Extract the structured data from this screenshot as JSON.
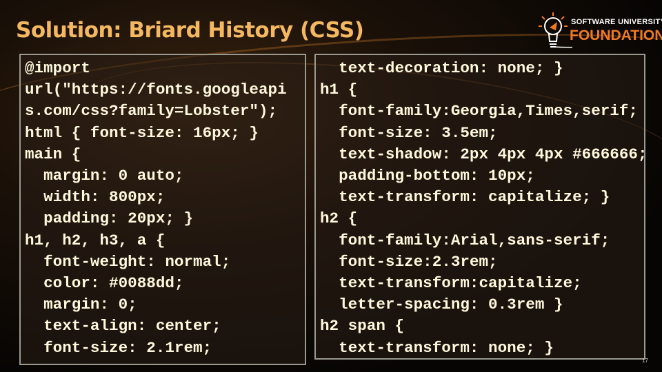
{
  "title": "Solution: Briard History (CSS)",
  "logo": {
    "line1": "SOFTWARE UNIVERSITY",
    "line2": "FOUNDATION"
  },
  "left_code": [
    "@import",
    "url(\"https://fonts.googleapi",
    "s.com/css?family=Lobster\");",
    "html { font-size: 16px; }",
    "main {",
    "  margin: 0 auto;",
    "  width: 800px;",
    "  padding: 20px; }",
    "h1, h2, h3, a {",
    "  font-weight: normal;",
    "  color: #0088dd;",
    "  margin: 0;",
    "  text-align: center;",
    "  font-size: 2.1rem;"
  ],
  "right_code": [
    "  text-decoration: none; }",
    "h1 {",
    "  font-family:Georgia,Times,serif;",
    "  font-size: 3.5em;",
    "  text-shadow: 2px 4px 4px #666666;",
    "  padding-bottom: 10px;",
    "  text-transform: capitalize; }",
    "h2 {",
    "  font-family:Arial,sans-serif;",
    "  font-size:2.3rem;",
    "  text-transform:capitalize;",
    "  letter-spacing: 0.3rem }",
    "h2 span {",
    "  text-transform: none; }"
  ],
  "page_number": "17"
}
